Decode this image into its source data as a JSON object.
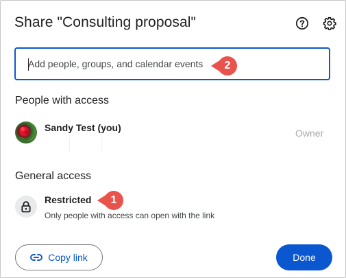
{
  "dialog": {
    "title": "Share \"Consulting proposal\"",
    "help_icon": "help-circle-icon",
    "settings_icon": "gear-icon"
  },
  "add_people": {
    "placeholder": "Add people, groups, and calendar events",
    "value": ""
  },
  "people_section": {
    "heading": "People with access",
    "people": [
      {
        "name": "Sandy Test (you)",
        "role": "Owner",
        "avatar": "flower-photo-avatar"
      }
    ]
  },
  "general_access": {
    "heading": "General access",
    "level": "Restricted",
    "description": "Only people with access can open with the link",
    "icon": "lock-icon"
  },
  "callouts": [
    {
      "number": "1",
      "color": "#e9534c"
    },
    {
      "number": "2",
      "color": "#e9534c"
    }
  ],
  "footer": {
    "copy_link_label": "Copy link",
    "copy_link_icon": "link-icon",
    "done_label": "Done"
  },
  "colors": {
    "accent": "#0b57d0",
    "callout": "#e9534c",
    "text": "#1f1f1f",
    "muted": "#a8a8a8"
  }
}
